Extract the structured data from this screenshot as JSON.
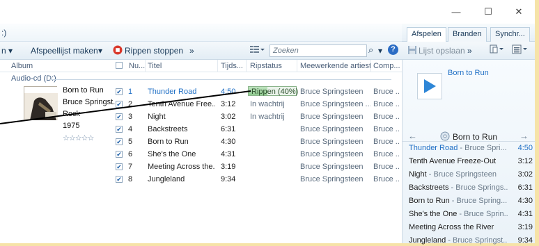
{
  "window": {
    "minimize_glyph": "—",
    "maximize_glyph": "☐",
    "close_glyph": "✕"
  },
  "address": {
    "crumb_fragment": ":)"
  },
  "right_tabs": {
    "play": "Afspelen",
    "burn": "Branden",
    "sync": "Synchr..."
  },
  "toolbar": {
    "organize_fragment": "n ▾",
    "create_playlist": "Afspeellijst maken",
    "create_playlist_arrow": "▾",
    "stop_rip": "Rippen stoppen",
    "more": "»",
    "search_placeholder": "Zoeken",
    "search_icon_glyph": "⌕",
    "search_arrow": "▾",
    "help_glyph": "?"
  },
  "right_toolbar": {
    "save_list": "Lijst opslaan",
    "more": "»"
  },
  "columns": {
    "album": "Album",
    "number": "Nu...",
    "title": "Titel",
    "duration": "Tijds...",
    "rip_status": "Ripstatus",
    "contributing_artist": "Meewerkende artiest",
    "composer": "Comp..."
  },
  "group_label": "Audio-cd (D:)",
  "album_info": {
    "album": "Born to Run",
    "artist": "Bruce Springst...",
    "genre": "Rock",
    "year": "1975",
    "rating_stars": "☆☆☆☆☆"
  },
  "rip_progress": {
    "text": "Rippen (40%)",
    "percent": 40
  },
  "tracks": [
    {
      "n": "1",
      "title": "Thunder Road",
      "dur": "4:50",
      "status": "",
      "artist": "Bruce Springsteen",
      "comp": "Bruce ..."
    },
    {
      "n": "2",
      "title": "Tenth Avenue Free...",
      "dur": "3:12",
      "status": "In wachtrij",
      "artist": "Bruce Springsteen ...",
      "comp": "Bruce ..."
    },
    {
      "n": "3",
      "title": "Night",
      "dur": "3:02",
      "status": "In wachtrij",
      "artist": "Bruce Springsteen",
      "comp": "Bruce ..."
    },
    {
      "n": "4",
      "title": "Backstreets",
      "dur": "6:31",
      "status": "",
      "artist": "Bruce Springsteen",
      "comp": "Bruce ..."
    },
    {
      "n": "5",
      "title": "Born to Run",
      "dur": "4:30",
      "status": "",
      "artist": "Bruce Springsteen",
      "comp": "Bruce ..."
    },
    {
      "n": "6",
      "title": "She's the One",
      "dur": "4:31",
      "status": "",
      "artist": "Bruce Springsteen",
      "comp": "Bruce ..."
    },
    {
      "n": "7",
      "title": "Meeting Across the...",
      "dur": "3:19",
      "status": "",
      "artist": "Bruce Springsteen",
      "comp": "Bruce ..."
    },
    {
      "n": "8",
      "title": "Jungleland",
      "dur": "9:34",
      "status": "",
      "artist": "Bruce Springsteen",
      "comp": "Bruce ..."
    }
  ],
  "right_pane": {
    "album_title": "Born to Run",
    "nav_back": "←",
    "nav_forward": "→",
    "nav_album": "Born to Run",
    "playlist": [
      {
        "title": "Thunder Road",
        "artist": " - Bruce Spri...",
        "dur": "4:50"
      },
      {
        "title": "Tenth Avenue Freeze-Out",
        "artist": "",
        "dur": "3:12"
      },
      {
        "title": "Night",
        "artist": " - Bruce Springsteen",
        "dur": "3:02"
      },
      {
        "title": "Backstreets",
        "artist": " - Bruce Springs...",
        "dur": "6:31"
      },
      {
        "title": "Born to Run",
        "artist": " - Bruce Spring...",
        "dur": "4:30"
      },
      {
        "title": "She's the One",
        "artist": " - Bruce Sprin...",
        "dur": "4:31"
      },
      {
        "title": "Meeting Across the River",
        "artist": "",
        "dur": "3:19"
      },
      {
        "title": "Jungleland",
        "artist": " - Bruce Springst...",
        "dur": "9:34"
      }
    ]
  },
  "colors": {
    "accent_blue": "#1f6fc5",
    "frame_yellow": "#f6e3a8",
    "progress_green": "#8fca8f"
  }
}
